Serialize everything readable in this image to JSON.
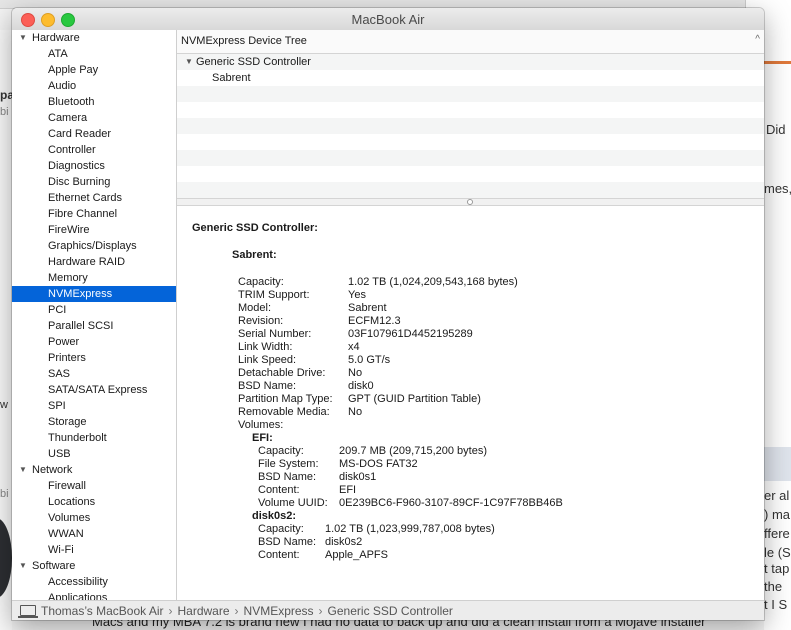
{
  "background": {
    "right_snippets": [
      "Did",
      "mes,",
      "er al",
      ") ma",
      "ffere",
      "le (S",
      "t tap",
      "the",
      "t I S"
    ],
    "left_snippets": [
      "pa",
      "bi",
      "w",
      "bi"
    ],
    "bottom_text": "Macs and my MBA 7.2 is brand new I had no data to back up and did a clean install from a Mojave installer"
  },
  "window": {
    "title": "MacBook Air"
  },
  "sidebar": {
    "groups": [
      {
        "label": "Hardware",
        "items": [
          "ATA",
          "Apple Pay",
          "Audio",
          "Bluetooth",
          "Camera",
          "Card Reader",
          "Controller",
          "Diagnostics",
          "Disc Burning",
          "Ethernet Cards",
          "Fibre Channel",
          "FireWire",
          "Graphics/Displays",
          "Hardware RAID",
          "Memory",
          "NVMExpress",
          "PCI",
          "Parallel SCSI",
          "Power",
          "Printers",
          "SAS",
          "SATA/SATA Express",
          "SPI",
          "Storage",
          "Thunderbolt",
          "USB"
        ]
      },
      {
        "label": "Network",
        "items": [
          "Firewall",
          "Locations",
          "Volumes",
          "WWAN",
          "Wi-Fi"
        ]
      },
      {
        "label": "Software",
        "items": [
          "Accessibility",
          "Applications"
        ]
      }
    ],
    "selected": "NVMExpress"
  },
  "header": {
    "title": "NVMExpress Device Tree",
    "chevron": "^"
  },
  "tree": {
    "rows": [
      "Generic SSD Controller",
      "Sabrent"
    ]
  },
  "detail": {
    "title": "Generic SSD Controller:",
    "device": "Sabrent:",
    "props": [
      {
        "k": "Capacity:",
        "v": "1.02 TB (1,024,209,543,168 bytes)"
      },
      {
        "k": "TRIM Support:",
        "v": "Yes"
      },
      {
        "k": "Model:",
        "v": "Sabrent"
      },
      {
        "k": "Revision:",
        "v": "ECFM12.3"
      },
      {
        "k": "Serial Number:",
        "v": "03F107961D4452195289"
      },
      {
        "k": "Link Width:",
        "v": "x4"
      },
      {
        "k": "Link Speed:",
        "v": "5.0 GT/s"
      },
      {
        "k": "Detachable Drive:",
        "v": "No"
      },
      {
        "k": "BSD Name:",
        "v": "disk0"
      },
      {
        "k": "Partition Map Type:",
        "v": "GPT (GUID Partition Table)"
      },
      {
        "k": "Removable Media:",
        "v": "No"
      },
      {
        "k": "Volumes:",
        "v": ""
      }
    ],
    "volumes": [
      {
        "name": "EFI:",
        "props": [
          {
            "k": "Capacity:",
            "v": "209.7 MB (209,715,200 bytes)"
          },
          {
            "k": "File System:",
            "v": "MS-DOS FAT32"
          },
          {
            "k": "BSD Name:",
            "v": "disk0s1"
          },
          {
            "k": "Content:",
            "v": "EFI"
          },
          {
            "k": "Volume UUID:",
            "v": "0E239BC6-F960-3107-89CF-1C97F78BB46B"
          }
        ]
      },
      {
        "name": "disk0s2:",
        "props": [
          {
            "k": "Capacity:",
            "v": "1.02 TB (1,023,999,787,008 bytes)"
          },
          {
            "k": "BSD Name:",
            "v": "disk0s2"
          },
          {
            "k": "Content:",
            "v": "Apple_APFS"
          }
        ]
      }
    ]
  },
  "statusbar": {
    "crumbs": [
      "Thomas’s MacBook Air",
      "Hardware",
      "NVMExpress",
      "Generic SSD Controller"
    ],
    "separator": "›"
  }
}
